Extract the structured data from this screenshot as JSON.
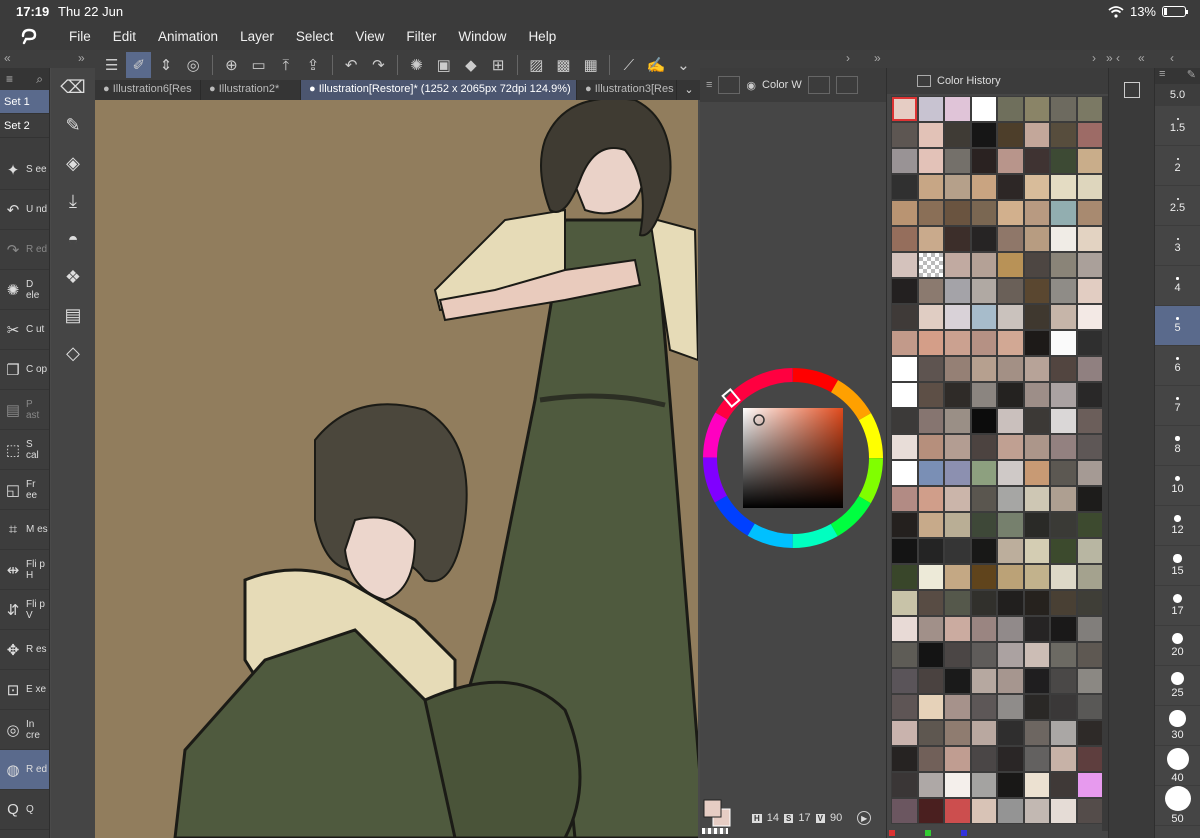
{
  "status": {
    "time": "17:19",
    "date": "Thu 22 Jun",
    "battery": "13%"
  },
  "menu": [
    "File",
    "Edit",
    "Animation",
    "Layer",
    "Select",
    "View",
    "Filter",
    "Window",
    "Help"
  ],
  "sets": [
    "Set 1",
    "Set 2"
  ],
  "left_tools": [
    {
      "icon": "new-icon",
      "label": "S ee"
    },
    {
      "icon": "undo-icon",
      "label": "U nd"
    },
    {
      "icon": "redo-icon",
      "label": "R ed"
    },
    {
      "icon": "deselect-icon",
      "label": "D ele"
    },
    {
      "icon": "cut-icon",
      "label": "C ut"
    },
    {
      "icon": "copy-icon",
      "label": "C op"
    },
    {
      "icon": "paste-icon",
      "label": "P ast"
    },
    {
      "icon": "scale-icon",
      "label": "S cal"
    },
    {
      "icon": "free-transform-icon",
      "label": "Fr ee"
    },
    {
      "icon": "mesh-icon",
      "label": "M es"
    },
    {
      "icon": "flip-h-icon",
      "label": "Fli p H"
    },
    {
      "icon": "flip-v-icon",
      "label": "Fli p V"
    },
    {
      "icon": "reset-icon",
      "label": "R es"
    },
    {
      "icon": "expand-icon",
      "label": "E xe"
    },
    {
      "icon": "increase-icon",
      "label": "In cre"
    },
    {
      "icon": "reduce-icon",
      "label": "R ed"
    },
    {
      "icon": "quick-icon",
      "label": "Q"
    }
  ],
  "tabs": [
    "Illustration6[Res",
    "Illustration2*",
    "Illustration[Restore]* (1252 x 2065px 72dpi 124.9%)",
    "Illustration3[Res"
  ],
  "color_panel": {
    "tab_label": "Color W",
    "h": "14",
    "s": "17",
    "v": "90"
  },
  "history_title": "Color History",
  "history_colors": [
    "#e6cdc4",
    "#c8c3d1",
    "#e0c4d8",
    "#ffffff",
    "#6f6f5c",
    "#8a8467",
    "#6d6a5f",
    "#7b7964",
    "#5d5652",
    "#e2c2b7",
    "#3f3b35",
    "#161616",
    "#4d3e2a",
    "#c3a79a",
    "#574d3d",
    "#9d6b66",
    "#999395",
    "#e3c2b8",
    "#74706a",
    "#2a2221",
    "#b8958b",
    "#3f3332",
    "#3d4a34",
    "#c9ad8a",
    "#303030",
    "#c7a685",
    "#b5a08a",
    "#c9a481",
    "#2d2726",
    "#d8bc9a",
    "#e4dcc3",
    "#ded6bd",
    "#b99472",
    "#8a6f57",
    "#6a5440",
    "#7a6752",
    "#d2b08d",
    "#b89a81",
    "#92aeb0",
    "#a88a70",
    "#956e5c",
    "#c9aa8c",
    "#3c2e2a",
    "#262424",
    "#8f7769",
    "#b79c81",
    "#f0ece6",
    "#e3d3c2",
    "#d4c2bc",
    "#trans",
    "#c1aaa1",
    "#b4a196",
    "#b89257",
    "#4d4642",
    "#8a8478",
    "#aaa09a",
    "#232020",
    "#8b7a6f",
    "#a4a3a8",
    "#b0a9a3",
    "#6a6058",
    "#5a4730",
    "#8f8c87",
    "#e2cdc2",
    "#3f3a38",
    "#e0cdc3",
    "#d9d2d8",
    "#a7bccb",
    "#cac2bd",
    "#3f382f",
    "#c6b5a9",
    "#f3e9e5",
    "#c29a8a",
    "#d49e88",
    "#cba190",
    "#b59184",
    "#d2a894",
    "#1d1a18",
    "#fafafa",
    "#2f2f2f",
    "#ffffff",
    "#5e5450",
    "#958075",
    "#b6a08f",
    "#a39085",
    "#b7a398",
    "#524540",
    "#908080",
    "#ffffff",
    "#5d4f46",
    "#2f2b28",
    "#8b8580",
    "#242220",
    "#9d8e88",
    "#aaa2a2",
    "#292828",
    "#3c3a39",
    "#867570",
    "#9a8f86",
    "#0c0c0c",
    "#cac0bd",
    "#3c3936",
    "#dad7d7",
    "#6b5e5a",
    "#e8ddd8",
    "#b68f7c",
    "#b39d92",
    "#4c4340",
    "#c0a092",
    "#ac968a",
    "#938180",
    "#5e5756",
    "#ffffff",
    "#7a8fb5",
    "#8c90b0",
    "#8da07f",
    "#cfc9c7",
    "#c89a74",
    "#5c5852",
    "#a59a94",
    "#b28b84",
    "#d09e8a",
    "#cbb5aa",
    "#5a564f",
    "#a6a6a4",
    "#cec7b4",
    "#ae9f91",
    "#1d1c1b",
    "#24201e",
    "#c7aa8a",
    "#b9ae95",
    "#3e4838",
    "#76806d",
    "#2a2a27",
    "#3a3a36",
    "#3d4a2f",
    "#141414",
    "#242424",
    "#353535",
    "#181817",
    "#bcae9c",
    "#d4cdb3",
    "#3c4a2d",
    "#b8b6a2",
    "#39462a",
    "#edead8",
    "#c4a884",
    "#60441c",
    "#bba277",
    "#c2b28c",
    "#ddd8c7",
    "#a4a28e",
    "#c8c3a8",
    "#584c44",
    "#55584b",
    "#31302c",
    "#211f1e",
    "#26221e",
    "#494034",
    "#3f3e37",
    "#e8dad6",
    "#a19089",
    "#cbaba0",
    "#9a8581",
    "#918a8a",
    "#262424",
    "#1a1919",
    "#817e7b",
    "#5e5c56",
    "#141414",
    "#4b4645",
    "#5f5c5a",
    "#aba2a1",
    "#ccbdb5",
    "#6c6a63",
    "#5e5852",
    "#5a5459",
    "#4a4240",
    "#1a1a1a",
    "#b6a8a0",
    "#a6968f",
    "#1f1e1f",
    "#4a4847",
    "#8b8883",
    "#5e5555",
    "#e6d2b9",
    "#a6928b",
    "#5d5757",
    "#8f8c8a",
    "#2a2826",
    "#3a3838",
    "#595856",
    "#c9b3ad",
    "#5e5750",
    "#8f7c70",
    "#b9a8a0",
    "#2f2e2e",
    "#6d6661",
    "#aaa7a5",
    "#2e2a28",
    "#262322",
    "#716059",
    "#c09d91",
    "#4a4646",
    "#2a2626",
    "#636160",
    "#c7b2a7",
    "#5e3e3e",
    "#3a3636",
    "#aea8a6",
    "#f4efeb",
    "#a4a3a1",
    "#191817",
    "#ece1d1",
    "#3f3937",
    "#e79aee",
    "#6b5660",
    "#4a1f1f",
    "#cc4e4e",
    "#d8c3b6",
    "#949494",
    "#c2b8b2",
    "#e5dcd6",
    "#544c4a"
  ],
  "brush_current": "5.0",
  "brush_sizes": [
    "1.5",
    "2",
    "2.5",
    "3",
    "4",
    "5",
    "6",
    "7",
    "8",
    "10",
    "12",
    "15",
    "17",
    "20",
    "25",
    "30",
    "40",
    "50"
  ]
}
